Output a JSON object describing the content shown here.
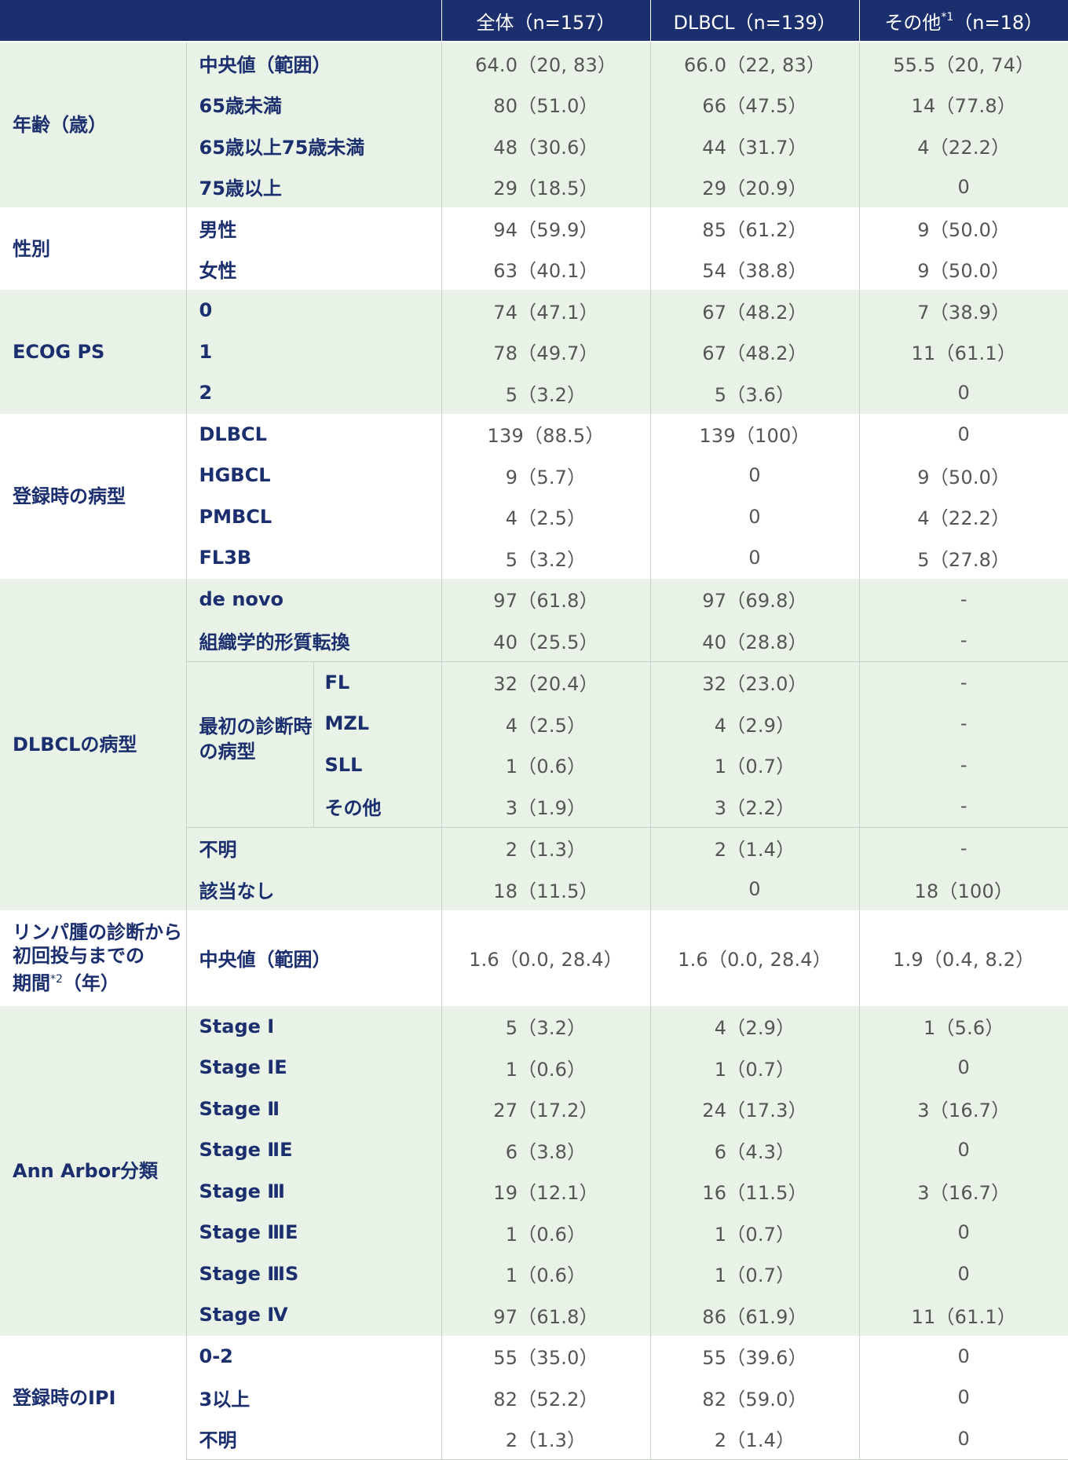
{
  "header": {
    "col_all": "全体（n=157）",
    "col_dlbcl": "DLBCL（n=139）",
    "col_other_prefix": "その他",
    "col_other_note": "*1",
    "col_other_suffix": "（n=18）"
  },
  "sections": {
    "age": {
      "label": "年齢（歳）",
      "rows": [
        {
          "label": "中央値（範囲）",
          "all": "64.0（20, 83）",
          "dlbcl": "66.0（22, 83）",
          "other": "55.5（20, 74）"
        },
        {
          "label": "65歳未満",
          "all": "80（51.0）",
          "dlbcl": "66（47.5）",
          "other": "14（77.8）"
        },
        {
          "label": "65歳以上75歳未満",
          "all": "48（30.6）",
          "dlbcl": "44（31.7）",
          "other": "4（22.2）"
        },
        {
          "label": "75歳以上",
          "all": "29（18.5）",
          "dlbcl": "29（20.9）",
          "other": "0"
        }
      ]
    },
    "sex": {
      "label": "性別",
      "rows": [
        {
          "label": "男性",
          "all": "94（59.9）",
          "dlbcl": "85（61.2）",
          "other": "9（50.0）"
        },
        {
          "label": "女性",
          "all": "63（40.1）",
          "dlbcl": "54（38.8）",
          "other": "9（50.0）"
        }
      ]
    },
    "ecog": {
      "label": "ECOG PS",
      "rows": [
        {
          "label": "0",
          "all": "74（47.1）",
          "dlbcl": "67（48.2）",
          "other": "7（38.9）"
        },
        {
          "label": "1",
          "all": "78（49.7）",
          "dlbcl": "67（48.2）",
          "other": "11（61.1）"
        },
        {
          "label": "2",
          "all": "5（3.2）",
          "dlbcl": "5（3.6）",
          "other": "0"
        }
      ]
    },
    "histology": {
      "label": "登録時の病型",
      "rows": [
        {
          "label": "DLBCL",
          "all": "139（88.5）",
          "dlbcl": "139（100）",
          "other": "0"
        },
        {
          "label": "HGBCL",
          "all": "9（5.7）",
          "dlbcl": "0",
          "other": "9（50.0）"
        },
        {
          "label": "PMBCL",
          "all": "4（2.5）",
          "dlbcl": "0",
          "other": "4（22.2）"
        },
        {
          "label": "FL3B",
          "all": "5（3.2）",
          "dlbcl": "0",
          "other": "5（27.8）"
        }
      ]
    },
    "dlbcl_type": {
      "label": "DLBCLの病型",
      "rows": [
        {
          "label": "de novo",
          "all": "97（61.8）",
          "dlbcl": "97（69.8）",
          "other": "-"
        },
        {
          "label": "組織学的形質転換",
          "all": "40（25.5）",
          "dlbcl": "40（28.8）",
          "other": "-"
        }
      ],
      "first_dx": {
        "label": "最初の診断時の病型",
        "rows": [
          {
            "label": "FL",
            "all": "32（20.4）",
            "dlbcl": "32（23.0）",
            "other": "-"
          },
          {
            "label": "MZL",
            "all": "4（2.5）",
            "dlbcl": "4（2.9）",
            "other": "-"
          },
          {
            "label": "SLL",
            "all": "1（0.6）",
            "dlbcl": "1（0.7）",
            "other": "-"
          },
          {
            "label": "その他",
            "all": "3（1.9）",
            "dlbcl": "3（2.2）",
            "other": "-"
          }
        ]
      },
      "rows_after": [
        {
          "label": "不明",
          "all": "2（1.3）",
          "dlbcl": "2（1.4）",
          "other": "-"
        },
        {
          "label": "該当なし",
          "all": "18（11.5）",
          "dlbcl": "0",
          "other": "18（100）"
        }
      ]
    },
    "interval": {
      "label_line1": "リンパ腫の診断から",
      "label_line2": "初回投与までの",
      "label_line3_prefix": "期間",
      "label_note": "*2",
      "label_line3_suffix": "（年）",
      "rows": [
        {
          "label": "中央値（範囲）",
          "all": "1.6（0.0, 28.4）",
          "dlbcl": "1.6（0.0, 28.4）",
          "other": "1.9（0.4, 8.2）"
        }
      ]
    },
    "ann_arbor": {
      "label": "Ann Arbor分類",
      "rows": [
        {
          "label": "Stage Ⅰ",
          "all": "5（3.2）",
          "dlbcl": "4（2.9）",
          "other": "1（5.6）"
        },
        {
          "label": "Stage ⅠE",
          "all": "1（0.6）",
          "dlbcl": "1（0.7）",
          "other": "0"
        },
        {
          "label": "Stage Ⅱ",
          "all": "27（17.2）",
          "dlbcl": "24（17.3）",
          "other": "3（16.7）"
        },
        {
          "label": "Stage ⅡE",
          "all": "6（3.8）",
          "dlbcl": "6（4.3）",
          "other": "0"
        },
        {
          "label": "Stage Ⅲ",
          "all": "19（12.1）",
          "dlbcl": "16（11.5）",
          "other": "3（16.7）"
        },
        {
          "label": "Stage ⅢE",
          "all": "1（0.6）",
          "dlbcl": "1（0.7）",
          "other": "0"
        },
        {
          "label": "Stage ⅢS",
          "all": "1（0.6）",
          "dlbcl": "1（0.7）",
          "other": "0"
        },
        {
          "label": "Stage Ⅳ",
          "all": "97（61.8）",
          "dlbcl": "86（61.9）",
          "other": "11（61.1）"
        }
      ]
    },
    "ipi": {
      "label": "登録時のIPI",
      "rows": [
        {
          "label": "0-2",
          "all": "55（35.0）",
          "dlbcl": "55（39.6）",
          "other": "0"
        },
        {
          "label": "3以上",
          "all": "82（52.2）",
          "dlbcl": "82（59.0）",
          "other": "0"
        },
        {
          "label": "不明",
          "all": "2（1.3）",
          "dlbcl": "2（1.4）",
          "other": "0"
        }
      ]
    }
  }
}
